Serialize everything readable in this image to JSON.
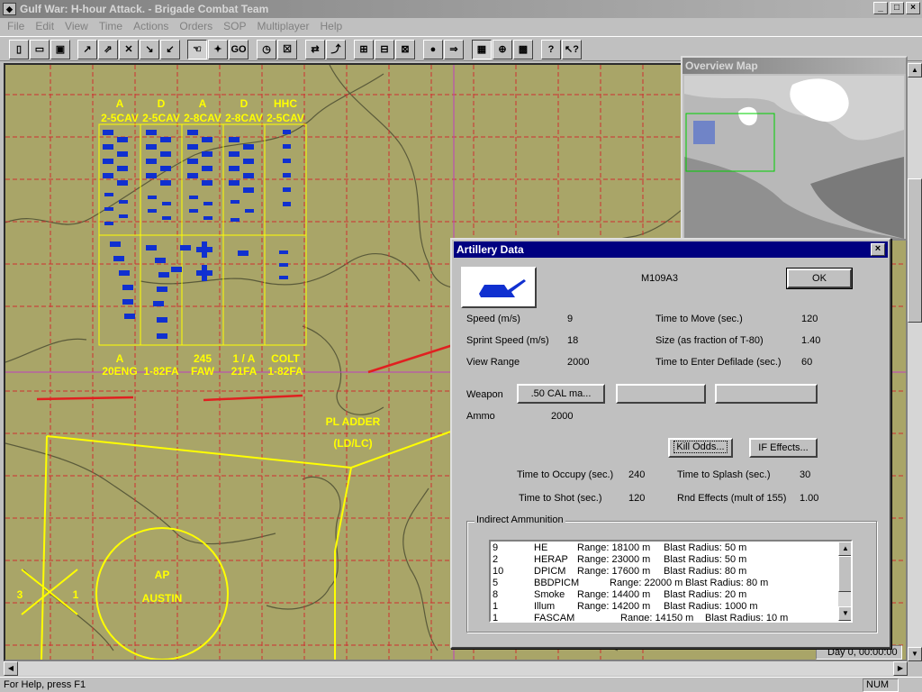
{
  "window": {
    "title": "Gulf War:  H-hour Attack. - Brigade Combat Team"
  },
  "menu": [
    "File",
    "Edit",
    "View",
    "Time",
    "Actions",
    "Orders",
    "SOP",
    "Multiplayer",
    "Help"
  ],
  "toolbar": {
    "buttons": [
      "new-icon",
      "open-icon",
      "save-icon",
      "tool-icon",
      "tool-icon",
      "tool-icon",
      "tool-icon",
      "tool-icon",
      "select-icon",
      "pointer-icon",
      "go-icon",
      "clock-icon",
      "cancel-icon",
      "order-icon",
      "order-icon",
      "order-icon",
      "order-icon",
      "order-icon",
      "stop-icon",
      "arrow-icon",
      "grid-icon",
      "zoom-icon",
      "map-icon",
      "help-icon",
      "context-help-icon"
    ],
    "go_label": "GO"
  },
  "map": {
    "unit_labels_top": [
      {
        "line1": "A",
        "line2": "2-5CAV"
      },
      {
        "line1": "D",
        "line2": "2-5CAV"
      },
      {
        "line1": "A",
        "line2": "2-8CAV"
      },
      {
        "line1": "D",
        "line2": "2-8CAV"
      },
      {
        "line1": "HHC",
        "line2": "2-5CAV"
      }
    ],
    "unit_labels_bottom": [
      {
        "line1": "A",
        "line2": "20ENG"
      },
      {
        "line1": "",
        "line2": "1-82FA"
      },
      {
        "line1": "245",
        "line2": "FAW"
      },
      {
        "line1": "1 / A",
        "line2": "21FA"
      },
      {
        "line1": "COLT",
        "line2": "1-82FA"
      }
    ],
    "phase_line": {
      "line1": "PL ADDER",
      "line2": "(LD/LC)"
    },
    "ap": {
      "line1": "AP",
      "line2": "AUSTIN"
    },
    "marker_left": "3",
    "marker_right": "1"
  },
  "overview": {
    "title": "Overview Map"
  },
  "time_display": "Day 0, 00:00:00",
  "status": {
    "help": "For Help, press F1",
    "num": "NUM"
  },
  "dialog": {
    "title": "Artillery Data",
    "close_label": "×",
    "unit_type": "M109A3",
    "ok_label": "OK",
    "stats_left": [
      {
        "label": "Speed (m/s)",
        "value": "9"
      },
      {
        "label": "Sprint Speed (m/s)",
        "value": "18"
      },
      {
        "label": "View Range",
        "value": "2000"
      }
    ],
    "stats_right": [
      {
        "label": "Time to Move (sec.)",
        "value": "120"
      },
      {
        "label": "Size (as fraction of T-80)",
        "value": "1.40"
      },
      {
        "label": "Time to Enter Defilade (sec.)",
        "value": "60"
      }
    ],
    "weapon_label": "Weapon",
    "weapon_buttons": [
      ".50 CAL ma...",
      "",
      ""
    ],
    "ammo_label": "Ammo",
    "ammo_value": "2000",
    "kill_odds_label": "Kill Odds...",
    "if_effects_label": "IF Effects...",
    "timing_left": [
      {
        "label": "Time to Occupy (sec.)",
        "value": "240"
      },
      {
        "label": "Time to Shot (sec.)",
        "value": "120"
      }
    ],
    "timing_right": [
      {
        "label": "Time to Splash (sec.)",
        "value": "30"
      },
      {
        "label": "Rnd Effects (mult of 155)",
        "value": "1.00"
      }
    ],
    "indirect_title": "Indirect Ammunition",
    "ammunition": [
      {
        "count": "9",
        "name": "HE",
        "range": "Range: 18100 m",
        "blast": "Blast Radius: 50 m"
      },
      {
        "count": "2",
        "name": "HERAP",
        "range": "Range: 23000 m",
        "blast": "Blast Radius: 50 m"
      },
      {
        "count": "10",
        "name": "DPICM",
        "range": "Range: 17600 m",
        "blast": "Blast Radius: 80 m"
      },
      {
        "count": "5",
        "name": "BBDPICM",
        "range": "Range: 22000 m",
        "blast": "Blast Radius: 80 m"
      },
      {
        "count": "8",
        "name": "Smoke",
        "range": "Range: 14400 m",
        "blast": "Blast Radius: 20 m"
      },
      {
        "count": "1",
        "name": "Illum",
        "range": "Range: 14200 m",
        "blast": "Blast Radius: 1000 m"
      },
      {
        "count": "1",
        "name": "FASCAM",
        "range": "Range: 14150 m",
        "blast": "Blast Radius: 10 m"
      }
    ]
  }
}
